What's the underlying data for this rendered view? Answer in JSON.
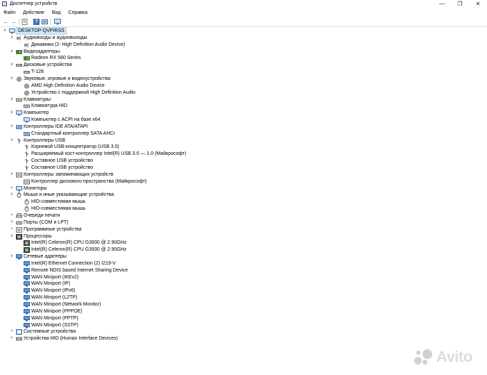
{
  "window": {
    "title": "Диспетчер устройств",
    "controls": {
      "minimize": "—",
      "maximize": "❐",
      "close": "✕"
    }
  },
  "menu": [
    "Файл",
    "Действие",
    "Вид",
    "Справка"
  ],
  "toolbar_icons": [
    "back-arrow-icon",
    "forward-arrow-icon",
    "properties-icon",
    "help-icon",
    "update-driver-icon",
    "monitor-icon"
  ],
  "tree": [
    {
      "level": 0,
      "expander": "∨",
      "icon": "computer-icon",
      "label": "DESKTOP-QVPIRSS",
      "selected": true
    },
    {
      "level": 1,
      "expander": "∨",
      "icon": "audio-io-icon",
      "label": "Аудиовходы и аудиовыходы"
    },
    {
      "level": 2,
      "expander": "",
      "icon": "speaker-icon",
      "label": "Динамики (2- High Definition Audio Device)"
    },
    {
      "level": 1,
      "expander": "∨",
      "icon": "display-adapter-icon",
      "label": "Видеоадаптеры"
    },
    {
      "level": 2,
      "expander": "",
      "icon": "display-adapter-icon",
      "label": "Radeon RX 580 Series"
    },
    {
      "level": 1,
      "expander": "∨",
      "icon": "disk-drive-icon",
      "label": "Дисковые устройства"
    },
    {
      "level": 2,
      "expander": "",
      "icon": "disk-drive-icon",
      "label": "T-128"
    },
    {
      "level": 1,
      "expander": "∨",
      "icon": "sound-controller-icon",
      "label": "Звуковые, игровые и видеоустройства"
    },
    {
      "level": 2,
      "expander": "",
      "icon": "sound-controller-icon",
      "label": "AMD High Definition Audio Device"
    },
    {
      "level": 2,
      "expander": "",
      "icon": "sound-controller-icon",
      "label": "Устройство с поддержкой High Definition Audio"
    },
    {
      "level": 1,
      "expander": "∨",
      "icon": "keyboard-icon",
      "label": "Клавиатуры"
    },
    {
      "level": 2,
      "expander": "",
      "icon": "keyboard-icon",
      "label": "Клавиатура HID"
    },
    {
      "level": 1,
      "expander": "∨",
      "icon": "computer-icon",
      "label": "Компьютер"
    },
    {
      "level": 2,
      "expander": "",
      "icon": "computer-icon",
      "label": "Компьютер с ACPI на базе x64"
    },
    {
      "level": 1,
      "expander": "∨",
      "icon": "ide-controller-icon",
      "label": "Контроллеры IDE ATA/ATAPI"
    },
    {
      "level": 2,
      "expander": "",
      "icon": "ide-controller-icon",
      "label": "Стандартный контроллер SATA AHCI"
    },
    {
      "level": 1,
      "expander": "∨",
      "icon": "usb-icon",
      "label": "Контроллеры USB"
    },
    {
      "level": 2,
      "expander": "",
      "icon": "usb-icon",
      "label": "Корневой USB-концентратор (USB 3.0)"
    },
    {
      "level": 2,
      "expander": "",
      "icon": "usb-icon",
      "label": "Расширяемый хост-контроллер Intel(R) USB 3.0 — 1.0 (Майкрософт)"
    },
    {
      "level": 2,
      "expander": "",
      "icon": "usb-icon",
      "label": "Составное USB устройство"
    },
    {
      "level": 2,
      "expander": "",
      "icon": "usb-icon",
      "label": "Составное USB устройство"
    },
    {
      "level": 1,
      "expander": "∨",
      "icon": "storage-controller-icon",
      "label": "Контроллеры запоминающих устройств"
    },
    {
      "level": 2,
      "expander": "",
      "icon": "storage-controller-icon",
      "label": "Контроллер дискового пространства (Майкрософт)"
    },
    {
      "level": 1,
      "expander": ">",
      "icon": "monitor-icon",
      "label": "Мониторы"
    },
    {
      "level": 1,
      "expander": "∨",
      "icon": "mouse-icon",
      "label": "Мыши и иные указывающие устройства"
    },
    {
      "level": 2,
      "expander": "",
      "icon": "mouse-icon",
      "label": "HID-совместимая мышь"
    },
    {
      "level": 2,
      "expander": "",
      "icon": "mouse-icon",
      "label": "HID-совместимая мышь"
    },
    {
      "level": 1,
      "expander": ">",
      "icon": "printer-icon",
      "label": "Очереди печати"
    },
    {
      "level": 1,
      "expander": ">",
      "icon": "port-icon",
      "label": "Порты (COM и LPT)"
    },
    {
      "level": 1,
      "expander": ">",
      "icon": "software-device-icon",
      "label": "Программные устройства"
    },
    {
      "level": 1,
      "expander": "∨",
      "icon": "processor-icon",
      "label": "Процессоры"
    },
    {
      "level": 2,
      "expander": "",
      "icon": "processor-icon",
      "label": "Intel(R) Celeron(R) CPU G3930 @ 2.90GHz"
    },
    {
      "level": 2,
      "expander": "",
      "icon": "processor-icon",
      "label": "Intel(R) Celeron(R) CPU G3930 @ 2.90GHz"
    },
    {
      "level": 1,
      "expander": "∨",
      "icon": "network-adapter-icon",
      "label": "Сетевые адаптеры"
    },
    {
      "level": 2,
      "expander": "",
      "icon": "network-adapter-icon",
      "label": "Intel(R) Ethernet Connection (2) I219-V"
    },
    {
      "level": 2,
      "expander": "",
      "icon": "network-adapter-icon",
      "label": "Remote NDIS based Internet Sharing Device"
    },
    {
      "level": 2,
      "expander": "",
      "icon": "network-adapter-icon",
      "label": "WAN Miniport (IKEv2)"
    },
    {
      "level": 2,
      "expander": "",
      "icon": "network-adapter-icon",
      "label": "WAN Miniport (IP)"
    },
    {
      "level": 2,
      "expander": "",
      "icon": "network-adapter-icon",
      "label": "WAN Miniport (IPv6)"
    },
    {
      "level": 2,
      "expander": "",
      "icon": "network-adapter-icon",
      "label": "WAN Miniport (L2TP)"
    },
    {
      "level": 2,
      "expander": "",
      "icon": "network-adapter-icon",
      "label": "WAN Miniport (Network Monitor)"
    },
    {
      "level": 2,
      "expander": "",
      "icon": "network-adapter-icon",
      "label": "WAN Miniport (PPPOE)"
    },
    {
      "level": 2,
      "expander": "",
      "icon": "network-adapter-icon",
      "label": "WAN Miniport (PPTP)"
    },
    {
      "level": 2,
      "expander": "",
      "icon": "network-adapter-icon",
      "label": "WAN Miniport (SSTP)"
    },
    {
      "level": 1,
      "expander": ">",
      "icon": "system-device-icon",
      "label": "Системные устройства"
    },
    {
      "level": 1,
      "expander": ">",
      "icon": "hid-icon",
      "label": "Устройства HID (Human Interface Devices)"
    }
  ],
  "watermark": {
    "text": "Avito",
    "icon": "avito-logo-icon"
  }
}
